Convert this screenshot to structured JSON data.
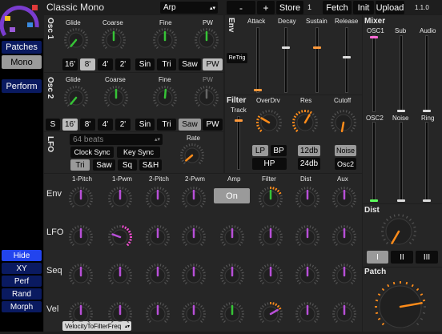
{
  "header": {
    "patch_name": "Classic Mono",
    "arp_select": "Arp",
    "minus": "-",
    "plus": "+",
    "store": "Store",
    "slot": "1",
    "fetch": "Fetch",
    "init": "Init",
    "upload": "Upload",
    "version": "1.1.0"
  },
  "sidebar": {
    "patches": "Patches",
    "mono": "Mono",
    "perform": "Perform",
    "hide": "Hide",
    "xy": "XY",
    "perf": "Perf",
    "rand": "Rand",
    "morph": "Morph"
  },
  "osc1": {
    "title": "Osc 1",
    "glide": "Glide",
    "coarse": "Coarse",
    "fine": "Fine",
    "pw": "PW",
    "octaves": [
      "16'",
      "8'",
      "4'",
      "2'"
    ],
    "waves": [
      "Sin",
      "Tri",
      "Saw",
      "PW"
    ],
    "selected_octave": "8'",
    "selected_wave": "PW"
  },
  "osc2": {
    "title": "Osc 2",
    "glide": "Glide",
    "coarse": "Coarse",
    "fine": "Fine",
    "pw": "PW",
    "s": "S",
    "octaves": [
      "16'",
      "8'",
      "4'",
      "2'"
    ],
    "waves": [
      "Sin",
      "Tri",
      "Saw",
      "PW"
    ],
    "selected_octave": "16'",
    "selected_wave": "Saw"
  },
  "lfo": {
    "title": "LFO",
    "beats": "64 beats",
    "clock_sync": "Clock Sync",
    "key_sync": "Key Sync",
    "rate": "Rate",
    "waves": [
      "Tri",
      "Saw",
      "Sq",
      "S&H"
    ],
    "selected_wave": "Tri"
  },
  "env": {
    "title": "Env",
    "attack": "Attack",
    "decay": "Decay",
    "sustain": "Sustain",
    "release": "Release",
    "retrig": "ReTrig",
    "attack_level": 0.02,
    "decay_level": 0.7,
    "sustain_level": 0.7,
    "release_level": 0.55
  },
  "filter": {
    "title": "Filter",
    "track": "Track",
    "overdrive": "OverDrv",
    "res": "Res",
    "cutoff": "Cutoff",
    "lp": "LP",
    "bp": "BP",
    "hp": "HP",
    "db12": "12db",
    "db24": "24db",
    "noise": "Noise",
    "osc2": "Osc2",
    "track_level": 0.95
  },
  "mixer": {
    "title": "Mixer",
    "osc1": "OSC1",
    "sub": "Sub",
    "audio": "Audio",
    "osc2": "OSC2",
    "noise": "Noise",
    "ring": "Ring",
    "levels": {
      "osc1": 1.0,
      "sub": 0.0,
      "audio": 0.0,
      "osc2": 0.0,
      "noise": 0.0,
      "ring": 0.0
    }
  },
  "matrix": {
    "columns": [
      "1-Pitch",
      "1-Pwm",
      "2-Pitch",
      "2-Pwm",
      "Amp",
      "Filter",
      "Dist",
      "Aux"
    ],
    "rows": [
      "Env",
      "LFO",
      "Seq",
      "Vel"
    ],
    "on_label": "On",
    "vel_select": "VelocityToFilterFreq"
  },
  "dist": {
    "title": "Dist",
    "modes": [
      "I",
      "II",
      "III"
    ],
    "selected_mode": "I"
  },
  "patch": {
    "title": "Patch"
  },
  "colors": {
    "accent_orange": "#ff8c1a",
    "knob_purple": "#b84fd8",
    "knob_green": "#36c436",
    "selected_navy": "#0a1a60",
    "track_orange": "#ff9a3c",
    "mixer_pink": "#ff6bd6",
    "mixer_green": "#5cff5c"
  }
}
